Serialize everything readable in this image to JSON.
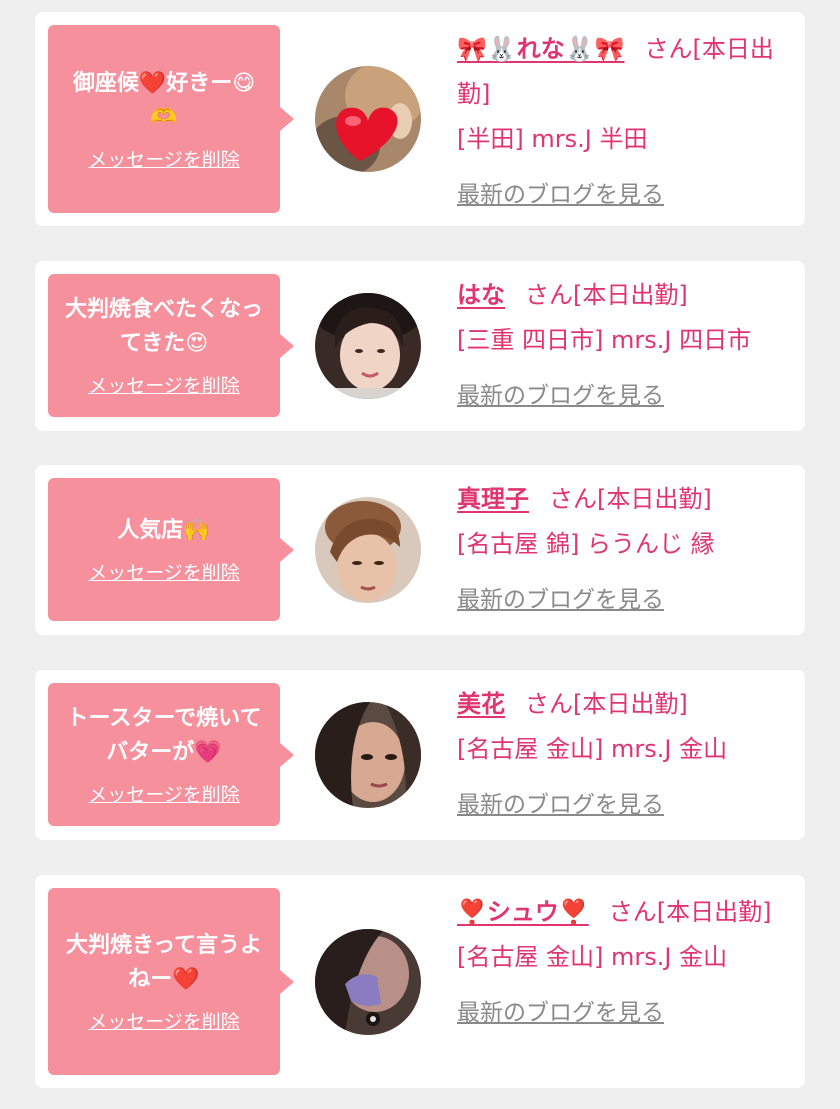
{
  "accent_color": "#e0356e",
  "bubble_color": "#f6909d",
  "cards": [
    {
      "message": "御座候❤️好きー😋🫶",
      "delete_label": "メッセージを削除",
      "name": "🎀🐰れな🐰🎀",
      "suffix": "さん[本日出勤]",
      "store": "[半田] mrs.J 半田",
      "blog_label": "最新のブログを見る",
      "avatar_icon": "heart-sticker-face"
    },
    {
      "message": "大判焼食べたくなってきた😍",
      "delete_label": "メッセージを削除",
      "name": "はな",
      "suffix": "さん[本日出勤]",
      "store": "[三重 四日市] mrs.J 四日市",
      "blog_label": "最新のブログを見る",
      "avatar_icon": "woman-portrait"
    },
    {
      "message": "人気店🙌",
      "delete_label": "メッセージを削除",
      "name": "真理子",
      "suffix": "さん[本日出勤]",
      "store": "[名古屋 錦] らうんじ 縁",
      "blog_label": "最新のブログを見る",
      "avatar_icon": "woman-portrait"
    },
    {
      "message": "トースターで焼いてバターが💗",
      "delete_label": "メッセージを削除",
      "name": "美花",
      "suffix": "さん[本日出勤]",
      "store": "[名古屋 金山] mrs.J 金山",
      "blog_label": "最新のブログを見る",
      "avatar_icon": "woman-portrait"
    },
    {
      "message": "大判焼きって言うよねー❤️",
      "delete_label": "メッセージを削除",
      "name": "❣️シュウ❣️",
      "suffix": "さん[本日出勤]",
      "store": "[名古屋 金山] mrs.J 金山",
      "blog_label": "最新のブログを見る",
      "avatar_icon": "woman-portrait"
    }
  ]
}
